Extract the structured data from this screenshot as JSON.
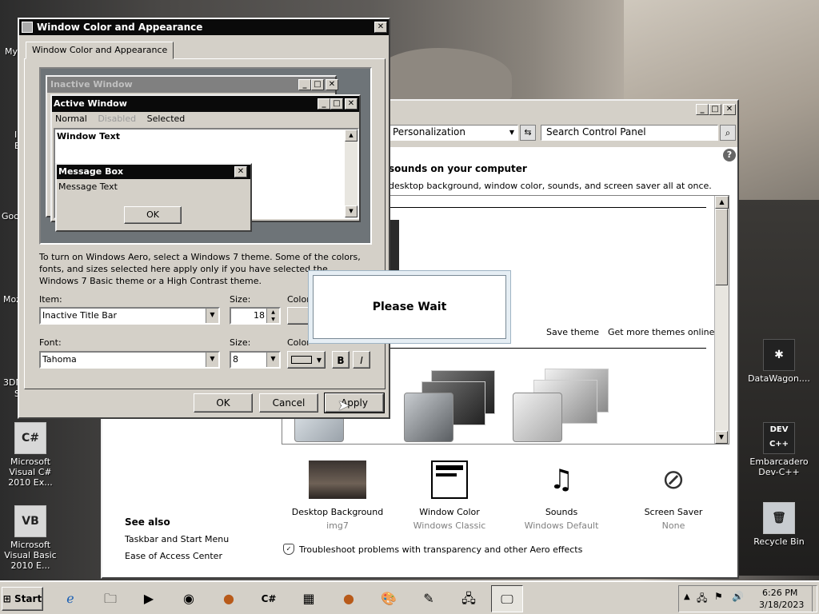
{
  "desktop": {
    "icons": [
      {
        "label": "Microsoft Visual C# 2010 Ex...",
        "glyph": "C#"
      },
      {
        "label": "Microsoft Visual Basic 2010 E...",
        "glyph": "VB"
      },
      {
        "label": "DataWagon....",
        "glyph": "✱"
      },
      {
        "label": "Embarcadero Dev-C++",
        "glyph": "DEV C++"
      },
      {
        "label": "Recycle Bin",
        "glyph": "🗑"
      }
    ],
    "partial_labels": [
      "My",
      "I",
      "E",
      "Goo",
      "Moz",
      "3DM",
      "S"
    ]
  },
  "appearance_dialog": {
    "title": "Window Color and Appearance",
    "tab": "Window Color and Appearance",
    "preview": {
      "inactive_title": "Inactive Window",
      "active_title": "Active Window",
      "menu": [
        "Normal",
        "Disabled",
        "Selected"
      ],
      "window_text": "Window Text",
      "msgbox_title": "Message Box",
      "msgbox_text": "Message Text",
      "msgbox_ok": "OK"
    },
    "info_text": "To turn on Windows Aero, select a Windows 7 theme.  Some of the colors, fonts, and sizes selected here apply only if you have selected the Windows 7 Basic theme or a High Contrast theme.",
    "item_label": "Item:",
    "item_value": "Inactive Title Bar",
    "size1_label": "Size:",
    "size1_value": "18",
    "color1_label": "Color",
    "font_label": "Font:",
    "font_value": "Tahoma",
    "size2_label": "Size:",
    "size2_value": "8",
    "color2_label": "Color",
    "bold": "B",
    "italic": "I",
    "ok": "OK",
    "cancel": "Cancel",
    "apply": "Apply"
  },
  "control_panel": {
    "breadcrumb": "Personalization",
    "search_placeholder": "Search Control Panel",
    "heading": "sounds on your computer",
    "subheading": "desktop background, window color, sounds, and screen saver all at once.",
    "save_theme": "Save theme",
    "more_themes": "Get more themes online",
    "settings": [
      {
        "title": "Desktop Background",
        "value": "img7"
      },
      {
        "title": "Window Color",
        "value": "Windows Classic"
      },
      {
        "title": "Sounds",
        "value": "Windows Default"
      },
      {
        "title": "Screen Saver",
        "value": "None"
      }
    ],
    "see_also_title": "See also",
    "see_also": [
      "Taskbar and Start Menu",
      "Ease of Access Center"
    ],
    "troubleshoot": "Troubleshoot problems with transparency and other Aero effects"
  },
  "please_wait": "Please Wait",
  "taskbar": {
    "start": "Start",
    "time": "6:26 PM",
    "date": "3/18/2023"
  }
}
